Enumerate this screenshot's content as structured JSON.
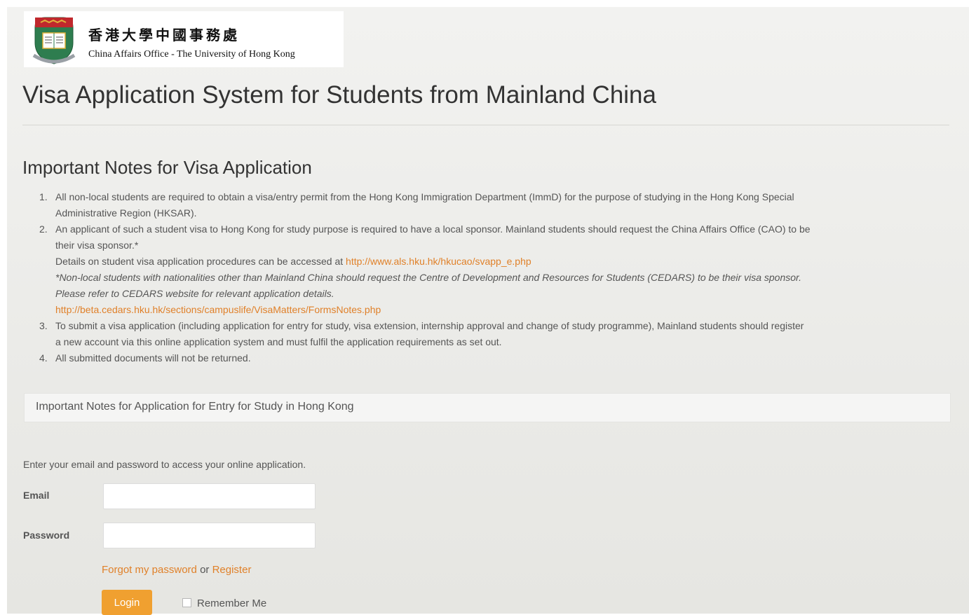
{
  "header": {
    "logo_zh": "香港大學中國事務處",
    "logo_en": "China Affairs Office - The University of Hong Kong",
    "page_title": "Visa Application System for Students from Mainland China"
  },
  "notes": {
    "title": "Important Notes for Visa Application",
    "items": [
      {
        "num": "1.",
        "line1": "All non-local students are required to obtain a visa/entry permit from the Hong Kong Immigration Department (ImmD) for the purpose of studying in the Hong Kong Special",
        "line2": "Administrative Region (HKSAR)."
      },
      {
        "num": "2.",
        "line1": "An applicant of such a student visa to Hong Kong for study purpose is required to have a local sponsor. Mainland students should request the China Affairs Office (CAO) to be",
        "line2": "their visa sponsor.*",
        "details_prefix": "Details on student visa application procedures can be accessed at",
        "details_link": "http://www.als.hku.hk/hkucao/svapp_e.php",
        "footnote1": "*Non-local students with nationalities other than Mainland China should request the Centre of Development and Resources for Students (CEDARS) to be their visa sponsor.",
        "footnote2": "Please refer to CEDARS website for relevant application details.",
        "cedars_link": "http://beta.cedars.hku.hk/sections/campuslife/VisaMatters/FormsNotes.php"
      },
      {
        "num": "3.",
        "line1": "To submit a visa application (including application for entry for study, visa extension, internship approval and change of study programme), Mainland students should register",
        "line2": "a new account via this online application system and must fulfil the application requirements as set out."
      },
      {
        "num": "4.",
        "line1": "All submitted documents will not be returned."
      }
    ]
  },
  "accordion": {
    "label": "Important Notes for Application for Entry for Study in Hong Kong"
  },
  "login": {
    "intro": "Enter your email and password to access your online application.",
    "email_label": "Email",
    "email_value": "",
    "password_label": "Password",
    "password_value": "",
    "forgot_label": "Forgot my password",
    "or_text": "or",
    "register_label": "Register",
    "login_button": "Login",
    "remember_label": "Remember Me"
  },
  "colors": {
    "link": "#e0812a",
    "button": "#f0a030",
    "crest_red": "#c0282d",
    "crest_green": "#2e7d4f",
    "crest_gold": "#e0b23a"
  }
}
